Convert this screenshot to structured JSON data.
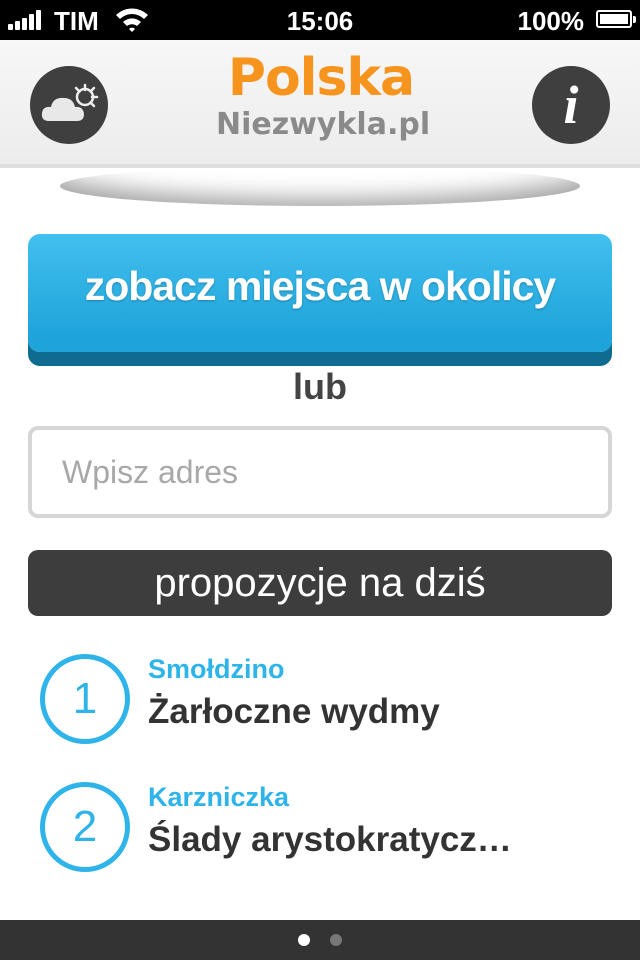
{
  "status_bar": {
    "carrier": "TIM",
    "time": "15:06",
    "battery": "100%"
  },
  "header": {
    "logo_main": "Polska",
    "logo_sub": "Niezwykla.pl",
    "info_label": "i",
    "icons": {
      "left": "weather-icon",
      "right": "info-icon"
    }
  },
  "main": {
    "nearby_button": "zobacz miejsca w okolicy",
    "or_label": "lub",
    "address_placeholder": "Wpisz adres",
    "section_title": "propozycje na dziś",
    "items": [
      {
        "number": "1",
        "place": "Smołdzino",
        "title": "Żarłoczne wydmy"
      },
      {
        "number": "2",
        "place": "Karzniczka",
        "title": "Ślady arystokratycz…"
      }
    ]
  },
  "pager": {
    "pages": 2,
    "active": 1
  },
  "colors": {
    "accent_blue": "#2fb4e9",
    "logo_orange": "#f7941d",
    "dark": "#3d3d3d"
  }
}
